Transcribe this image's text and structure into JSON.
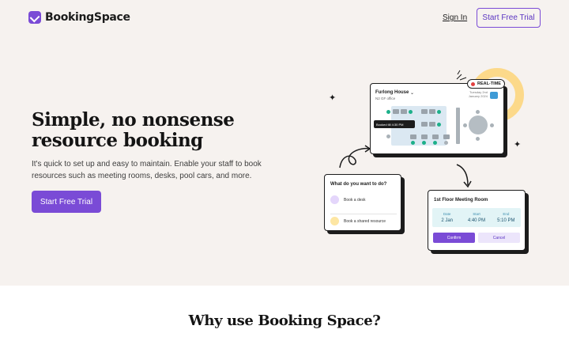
{
  "header": {
    "brand": "BookingSpace",
    "sign_in": "Sign In",
    "cta": "Start Free Trial"
  },
  "hero": {
    "title_line1": "Simple, no nonsense",
    "title_line2": "resource booking",
    "subtitle_line1": "It's quick to set up and easy to maintain. Enable your staff to book",
    "subtitle_line2": "resources such as meeting rooms, desks, pool cars, and more.",
    "cta": "Start Free Trial"
  },
  "illustration": {
    "badge": "REAL-TIME",
    "floor": {
      "name": "Furlong House",
      "sub": "N2 GF office",
      "date_line1": "Tuesday 2nd",
      "date_line2": "January 2024",
      "tooltip": "Booked till 4:30 PM"
    },
    "question": {
      "title": "What do you want to do?",
      "option1": "Book a desk",
      "option2": "Book a shared resource"
    },
    "meeting": {
      "title": "1st Floor Meeting Room",
      "date_label": "Date",
      "date_value": "2 Jan",
      "start_label": "Start",
      "start_value": "4:40 PM",
      "end_label": "End",
      "end_value": "5:10 PM",
      "confirm": "Confirm",
      "cancel": "Cancel"
    }
  },
  "section": {
    "title": "Why use Booking Space?"
  },
  "colors": {
    "accent": "#7a4bd6",
    "hero_bg": "#f6f2ef",
    "seat_available": "#1db08a",
    "ring": "#fcd98a"
  }
}
